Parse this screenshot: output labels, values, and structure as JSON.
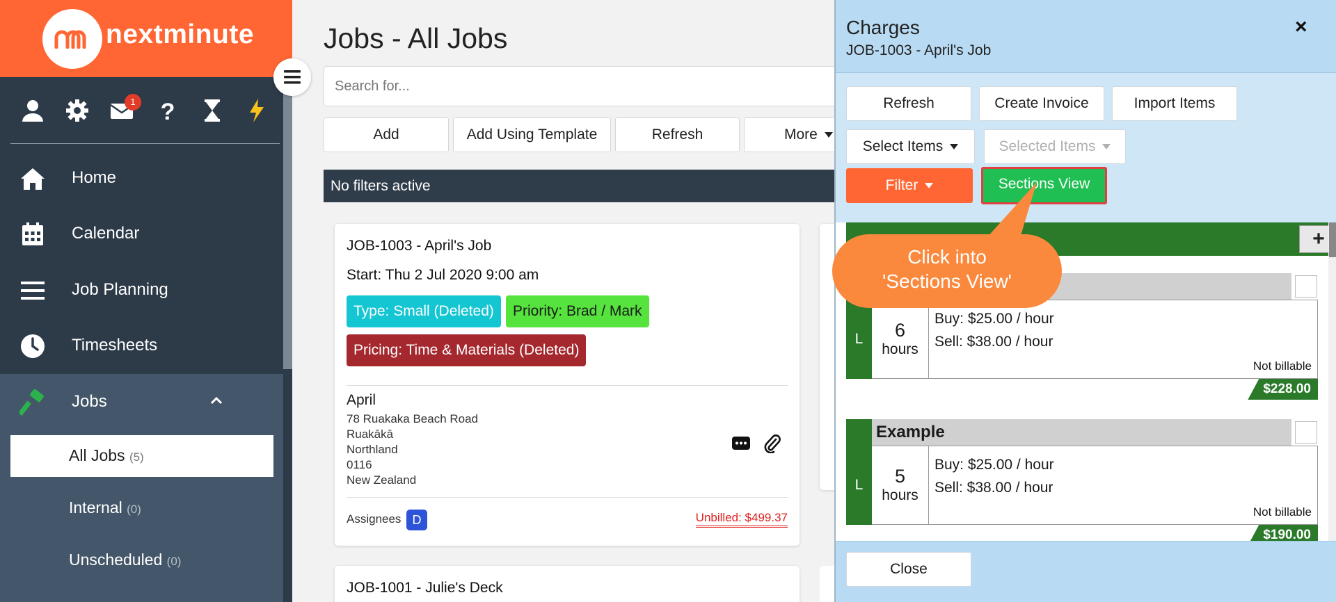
{
  "brand": {
    "logo_text": "nextminute",
    "primary": "#ff6633",
    "sidebar_bg": "#2d3a48"
  },
  "header_icons": [
    "user-icon",
    "gear-icon",
    "mail-icon",
    "help-icon",
    "hourglass-icon",
    "lightning-icon"
  ],
  "mail_badge": "1",
  "nav": {
    "home": "Home",
    "calendar": "Calendar",
    "job_planning": "Job Planning",
    "timesheets": "Timesheets",
    "jobs": "Jobs"
  },
  "jobs_sub": {
    "all_jobs": {
      "label": "All Jobs",
      "count": "(5)"
    },
    "internal": {
      "label": "Internal",
      "count": "(0)"
    },
    "unscheduled": {
      "label": "Unscheduled",
      "count": "(0)"
    }
  },
  "page": {
    "title": "Jobs - All Jobs",
    "search_placeholder": "Search for...",
    "toolbar": {
      "add": "Add",
      "add_template": "Add Using Template",
      "refresh": "Refresh",
      "more": "More"
    },
    "filters_text": "No filters active"
  },
  "job_card": {
    "title": "JOB-1003 - April's Job",
    "start": "Start: Thu 2 Jul 2020 9:00 am",
    "type_tag": "Type: Small (Deleted)",
    "priority_tag": "Priority: Brad / Mark",
    "pricing_tag": "Pricing: Time & Materials (Deleted)",
    "client": "April",
    "address": [
      "78 Ruakaka Beach Road",
      "Ruakākā",
      "Northland",
      "0116",
      "New Zealand"
    ],
    "assignees_label": "Assignees",
    "assignee_initial": "D",
    "unbilled": "Unbilled: $499.37"
  },
  "job_card_2": {
    "title": "JOB-1001 - Julie's Deck"
  },
  "charges": {
    "title": "Charges",
    "subtitle": "JOB-1003 - April's Job",
    "close_x": "×",
    "buttons": {
      "refresh": "Refresh",
      "create_invoice": "Create Invoice",
      "import_items": "Import Items",
      "select_items": "Select Items",
      "selected_items": "Selected Items",
      "filter": "Filter",
      "sections_view": "Sections View",
      "add_section": "+",
      "close": "Close"
    },
    "items": [
      {
        "name": "",
        "type": "L",
        "qty": "6",
        "unit": "hours",
        "buy": "Buy: $25.00 / hour",
        "sell": "Sell: $38.00 / hour",
        "billable": "Not billable",
        "total": "$228.00"
      },
      {
        "name": "Example",
        "type": "L",
        "qty": "5",
        "unit": "hours",
        "buy": "Buy: $25.00 / hour",
        "sell": "Sell: $38.00 / hour",
        "billable": "Not billable",
        "total": "$190.00"
      }
    ]
  },
  "callout": {
    "line1": "Click into",
    "line2": "'Sections View'"
  }
}
